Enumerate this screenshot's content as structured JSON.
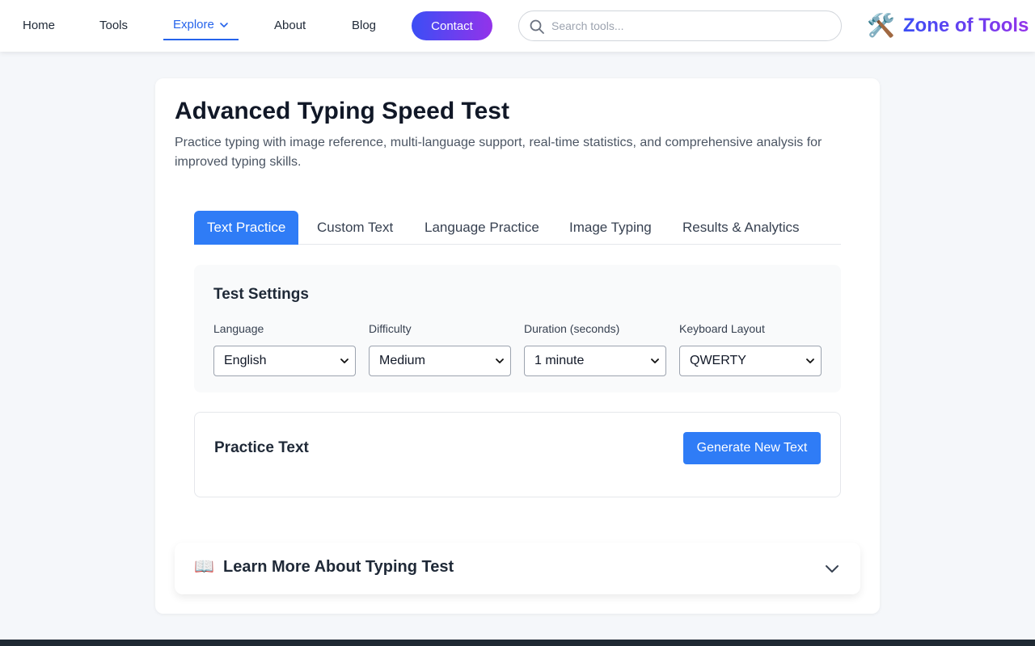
{
  "nav": {
    "home": "Home",
    "tools": "Tools",
    "explore": "Explore",
    "about": "About",
    "blog": "Blog",
    "contact": "Contact",
    "search_placeholder": "Search tools...",
    "brand_icon": "🛠️",
    "brand_name": "Zone of Tools"
  },
  "page": {
    "title": "Advanced Typing Speed Test",
    "description": "Practice typing with image reference, multi-language support, real-time statistics, and comprehensive analysis for improved typing skills."
  },
  "tabs": [
    {
      "label": "Text Practice",
      "active": true
    },
    {
      "label": "Custom Text",
      "active": false
    },
    {
      "label": "Language Practice",
      "active": false
    },
    {
      "label": "Image Typing",
      "active": false
    },
    {
      "label": "Results & Analytics",
      "active": false
    }
  ],
  "settings": {
    "title": "Test Settings",
    "fields": [
      {
        "label": "Language",
        "value": "English"
      },
      {
        "label": "Difficulty",
        "value": "Medium"
      },
      {
        "label": "Duration (seconds)",
        "value": "1 minute"
      },
      {
        "label": "Keyboard Layout",
        "value": "QWERTY"
      }
    ]
  },
  "practice": {
    "title": "Practice Text",
    "generate_label": "Generate New Text"
  },
  "learn_more": {
    "icon": "📖",
    "title": "Learn More About Typing Test"
  },
  "colors": {
    "accent": "#2f7cf6",
    "brand_gradient_start": "#3b4ef5",
    "brand_gradient_end": "#9333ea"
  }
}
